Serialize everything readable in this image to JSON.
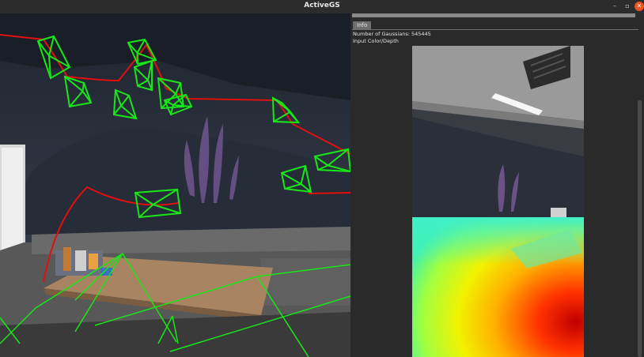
{
  "window": {
    "title": "ActiveGS",
    "minimize_glyph": "–",
    "maximize_glyph": "▫",
    "close_glyph": "✕"
  },
  "panel": {
    "tab_label": "Info",
    "gaussians_text": "Number of Gaussians: 545445",
    "input_label": "Input Color/Depth"
  },
  "colors": {
    "trajectory": "#e01010",
    "camera_frustum": "#19e619",
    "close_button": "#e95420"
  }
}
